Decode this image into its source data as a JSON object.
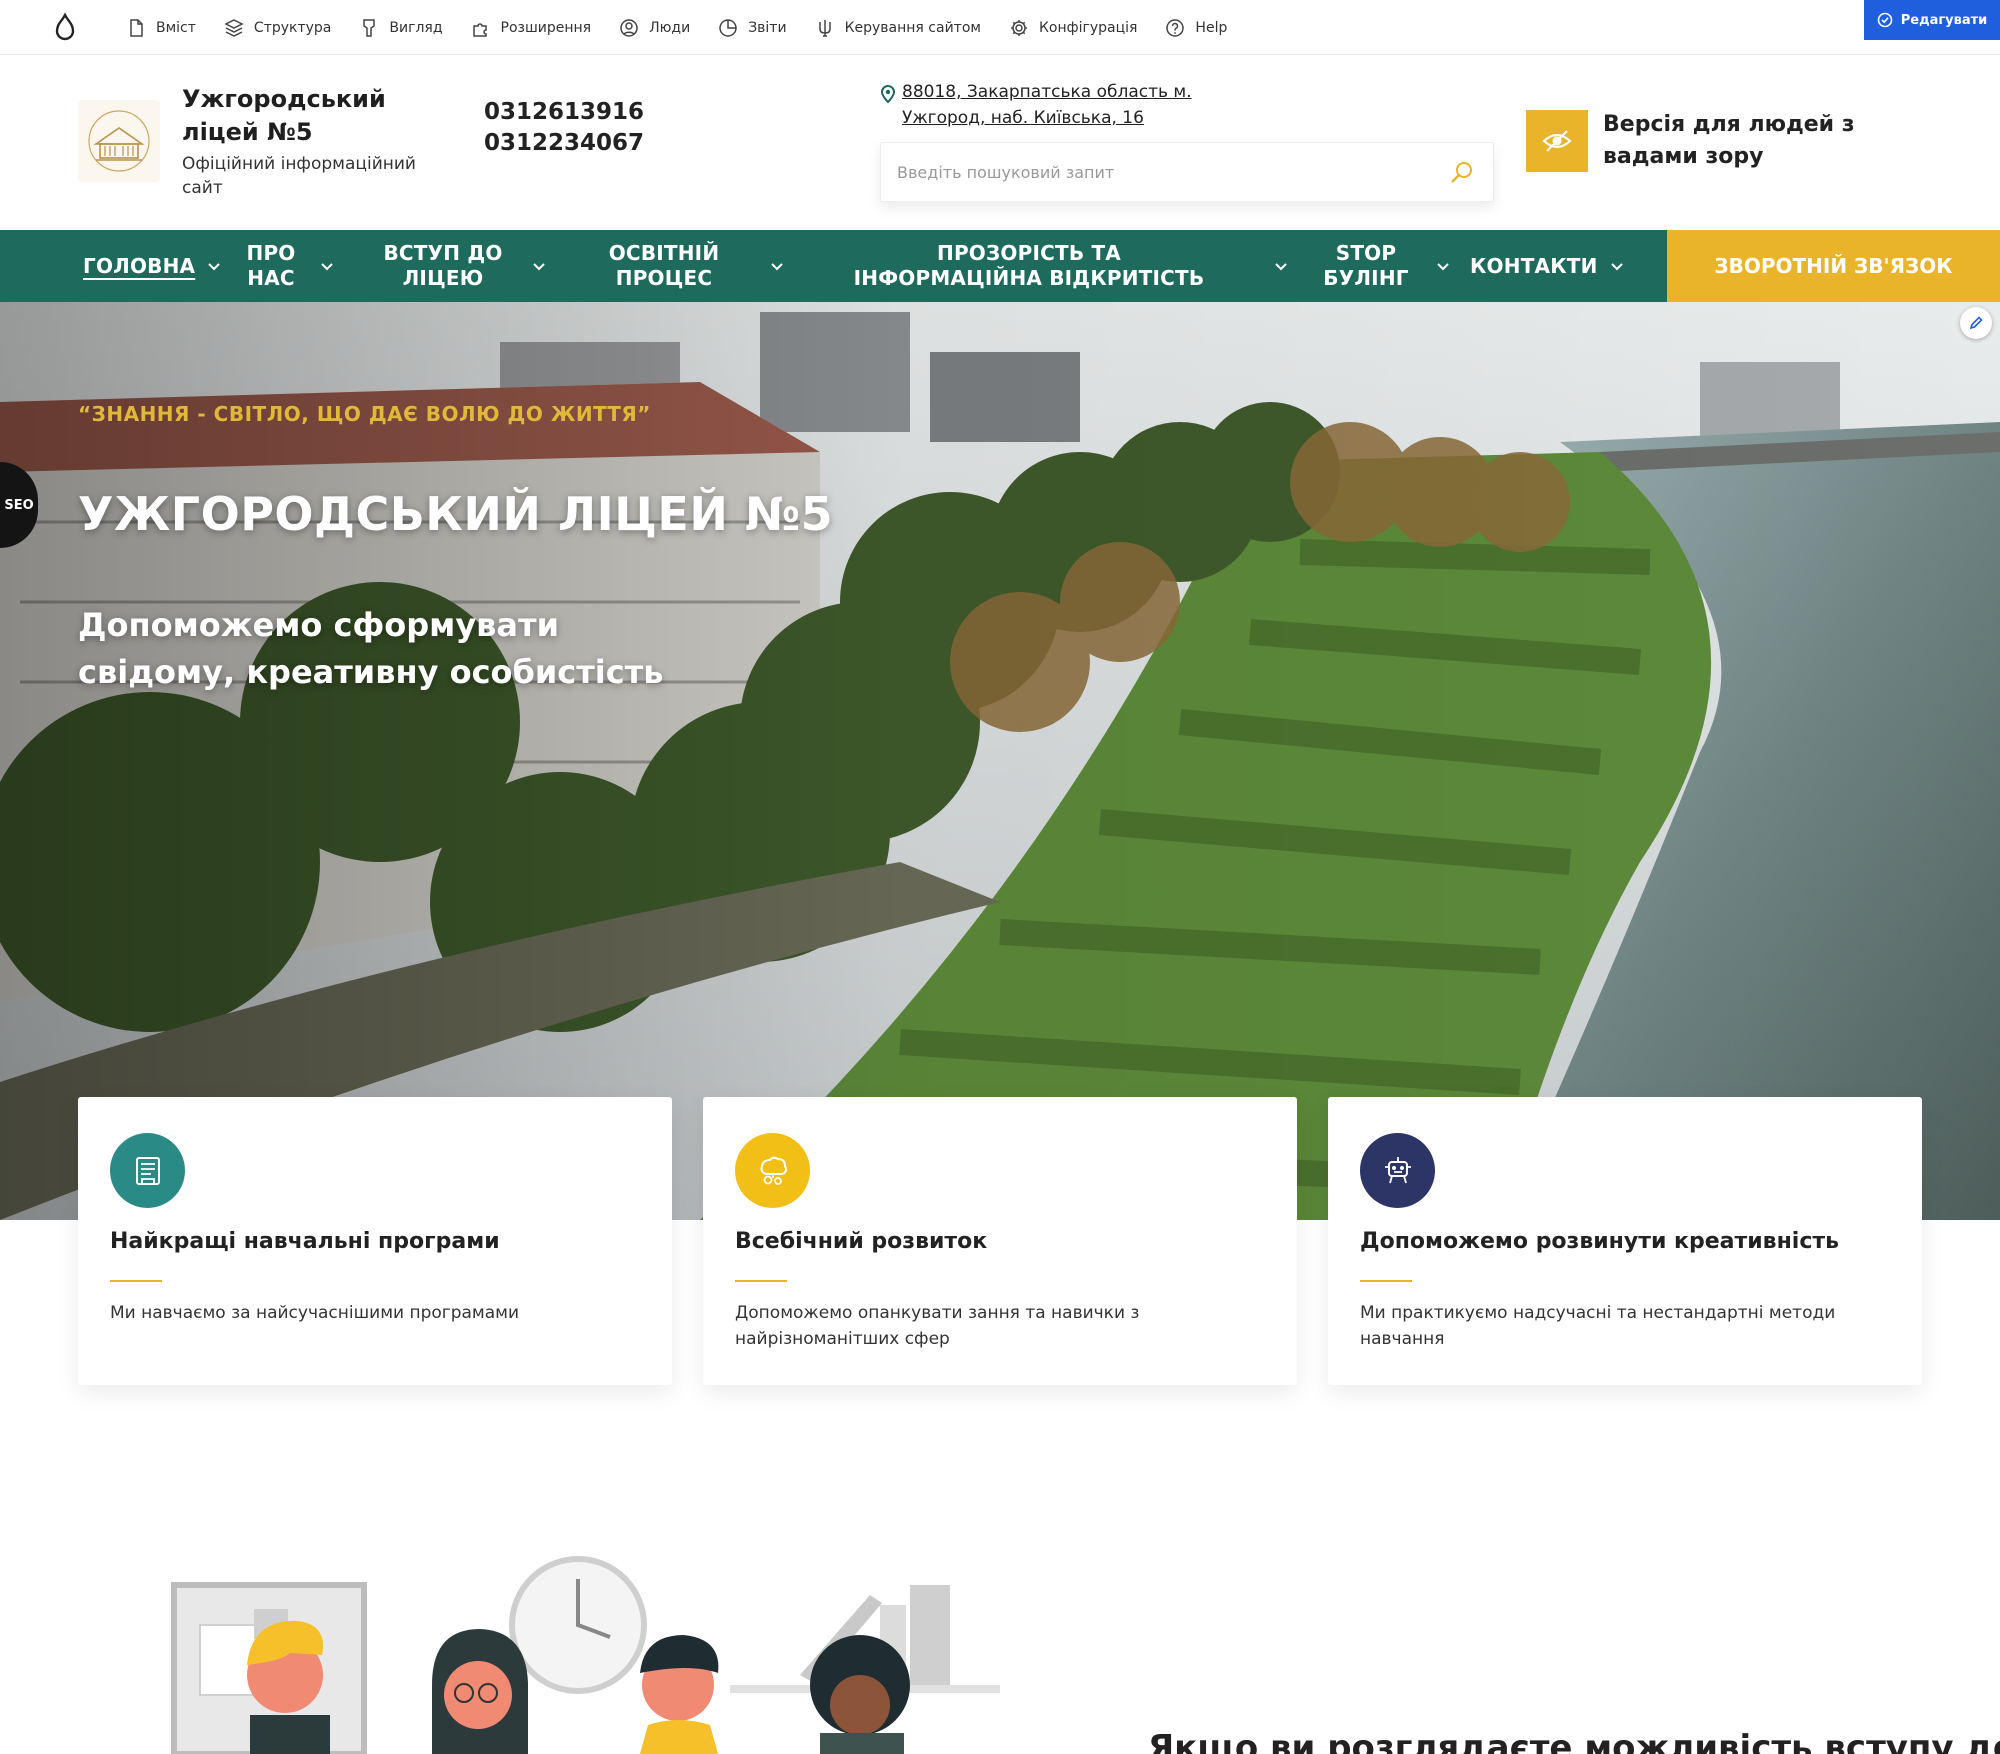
{
  "admin_toolbar": {
    "items": [
      {
        "label": "Вміст",
        "icon": "file-icon"
      },
      {
        "label": "Структура",
        "icon": "layers-icon"
      },
      {
        "label": "Вигляд",
        "icon": "brush-icon"
      },
      {
        "label": "Розширення",
        "icon": "puzzle-icon"
      },
      {
        "label": "Люди",
        "icon": "user-circle-icon"
      },
      {
        "label": "Звіти",
        "icon": "pie-chart-icon"
      },
      {
        "label": "Керування сайтом",
        "icon": "trident-icon"
      },
      {
        "label": "Конфігурація",
        "icon": "gear-icon"
      },
      {
        "label": "Help",
        "icon": "help-icon"
      }
    ],
    "edit_label": "Редагувати"
  },
  "header": {
    "site_name": "Ужгородський ліцей №5",
    "slogan": "Офіційний інформаційний сайт",
    "phones": [
      "0312613916",
      "0312234067"
    ],
    "address": "88018, Закарпатська область м. Ужгород, наб. Київська, 16",
    "search_placeholder": "Введіть пошуковий запит",
    "accessibility_label": "Версія для людей з вадами зору"
  },
  "nav": {
    "items": [
      {
        "label": "ГОЛОВНА"
      },
      {
        "label": "ПРО НАС"
      },
      {
        "label": "ВСТУП ДО ЛІЦЕЮ"
      },
      {
        "label": "ОСВІТНІЙ ПРОЦЕС"
      },
      {
        "label": "ПРОЗОРІСТЬ ТА ІНФОРМАЦІЙНА ВІДКРИТІСТЬ"
      },
      {
        "label": "STOP БУЛІНГ"
      },
      {
        "label": "КОНТАКТИ"
      }
    ],
    "feedback_label": "ЗВОРОТНІЙ ЗВ'ЯЗОК"
  },
  "hero": {
    "motto": "“ЗНАННЯ - СВІТЛО, ЩО ДАЄ ВОЛЮ ДО ЖИТТЯ”",
    "title": "УЖГОРОДСЬКИЙ ЛІЦЕЙ №5",
    "subtitle": "Допоможемо сформувати свідому, креативну особистість",
    "seo_label": "SEO"
  },
  "features": [
    {
      "title": "Найкращі навчальні програми",
      "text": "Ми навчаємо за найсучаснішими програмами",
      "icon": "book-icon",
      "color": "#2a8a85"
    },
    {
      "title": "Всебічний розвиток",
      "text": "Допоможемо опанкувати зання та навички з найрізноманітших сфер",
      "icon": "brain-gears-icon",
      "color": "#f2bf17"
    },
    {
      "title": "Допоможемо розвинути креативність",
      "text": "Ми практикуємо надсучасні та нестандартні методи навчання",
      "icon": "robot-icon",
      "color": "#2c3566"
    }
  ],
  "admission": {
    "heading": "Якщо ви розглядаєте можливість вступу до"
  },
  "colors": {
    "nav_green": "#1e6b5e",
    "accent_gold": "#e9b42a",
    "admin_blue": "#1f5fde"
  }
}
